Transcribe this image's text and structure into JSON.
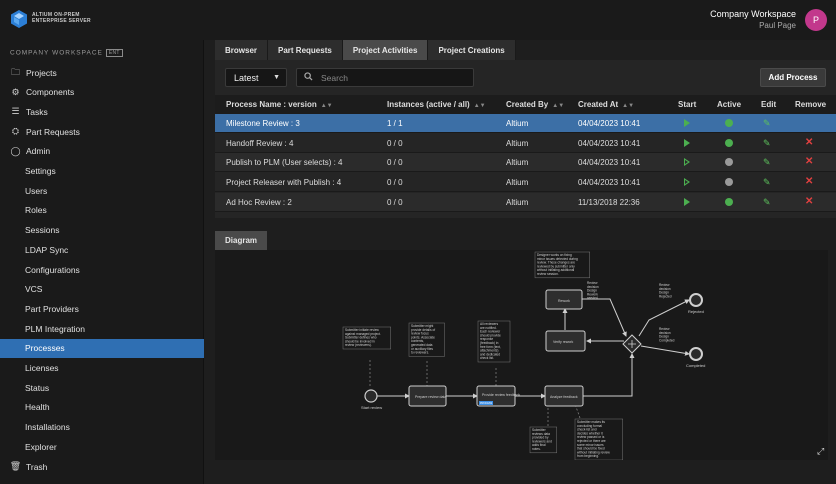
{
  "brand": {
    "line1": "ALTIUM ON-PREM",
    "line2": "ENTERPRISE SERVER"
  },
  "header": {
    "workspace": "Company Workspace",
    "user": "Paul Page",
    "avatar_initial": "P",
    "avatar_color": "#c2388c"
  },
  "sidebar": {
    "section": "COMPANY WORKSPACE",
    "badge": "ENT",
    "items": [
      {
        "label": "Projects",
        "icon": "folder-icon",
        "sub": false
      },
      {
        "label": "Components",
        "icon": "components-icon",
        "sub": false
      },
      {
        "label": "Tasks",
        "icon": "tasks-icon",
        "sub": false
      },
      {
        "label": "Part Requests",
        "icon": "part-requests-icon",
        "sub": false
      },
      {
        "label": "Admin",
        "icon": "admin-icon",
        "sub": false
      },
      {
        "label": "Settings",
        "sub": true
      },
      {
        "label": "Users",
        "sub": true
      },
      {
        "label": "Roles",
        "sub": true
      },
      {
        "label": "Sessions",
        "sub": true
      },
      {
        "label": "LDAP Sync",
        "sub": true
      },
      {
        "label": "Configurations",
        "sub": true
      },
      {
        "label": "VCS",
        "sub": true
      },
      {
        "label": "Part Providers",
        "sub": true
      },
      {
        "label": "PLM Integration",
        "sub": true
      },
      {
        "label": "Processes",
        "sub": true,
        "active": true
      },
      {
        "label": "Licenses",
        "sub": true
      },
      {
        "label": "Status",
        "sub": true
      },
      {
        "label": "Health",
        "sub": true
      },
      {
        "label": "Installations",
        "sub": true
      },
      {
        "label": "Explorer",
        "sub": true
      },
      {
        "label": "Trash",
        "icon": "trash-icon",
        "sub": false
      }
    ]
  },
  "tabs": [
    "Browser",
    "Part Requests",
    "Project Activities",
    "Project Creations"
  ],
  "active_tab": "Project Activities",
  "toolbar": {
    "filter_value": "Latest",
    "search_placeholder": "Search",
    "add_label": "Add Process"
  },
  "table": {
    "columns": [
      "Process Name : version",
      "Instances (active / all)",
      "Created By",
      "Created At",
      "Start",
      "Active",
      "Edit",
      "Remove"
    ],
    "rows": [
      {
        "name": "Milestone Review : 3",
        "instances": "1 / 1",
        "by": "Altium",
        "at": "04/04/2023 10:41",
        "start_filled": true,
        "active": true,
        "selected": true
      },
      {
        "name": "Handoff Review : 4",
        "instances": "0 / 0",
        "by": "Altium",
        "at": "04/04/2023 10:41",
        "start_filled": true,
        "active": true
      },
      {
        "name": "Publish to PLM (User selects) : 4",
        "instances": "0 / 0",
        "by": "Altium",
        "at": "04/04/2023 10:41",
        "start_filled": false,
        "active": false
      },
      {
        "name": "Project Releaser with Publish : 4",
        "instances": "0 / 0",
        "by": "Altium",
        "at": "04/04/2023 10:41",
        "start_filled": false,
        "active": false
      },
      {
        "name": "Ad Hoc Review : 2",
        "instances": "0 / 0",
        "by": "Altium",
        "at": "11/13/2018 22:36",
        "start_filled": true,
        "active": true
      }
    ]
  },
  "status_colors": {
    "active": "#4caf50",
    "inactive": "#9a9a9a",
    "start": "#4caf50",
    "edit": "#5cc05c",
    "remove": "#e04040"
  },
  "diagram": {
    "tab": "Diagram",
    "nodes": {
      "start": "Start review",
      "prepare": "Prepare review data",
      "provide": "Provide review feedback",
      "analyze": "Analyze feedback",
      "rework": "Rework",
      "verify": "Verify rework",
      "rejected": "Rejected",
      "completed": "Completed",
      "badge": "PROCESS"
    },
    "notes": {
      "n1": [
        "Submitter initiate review",
        "against managed project.",
        "Submitter defines who",
        "should be involved in",
        "review (reviewers)."
      ],
      "n2": [
        "Submitter might",
        "provide details of",
        "review focus",
        "points. Associate",
        "contents,",
        "generated data",
        "or auxiliary files",
        "to reviewers."
      ],
      "n3": [
        "All reviewers",
        "are notified.",
        "Each reviewer",
        "should provide",
        "response",
        "(feedback) in",
        "free form (text,",
        "attachments)",
        "and dedicated",
        "check list."
      ],
      "n4": [
        "Designer works on fixing",
        "minor issues detected during",
        "review. These changes are",
        "reviewed by submitter only",
        "without initiating additional",
        "review session."
      ],
      "n5": [
        "Submitter",
        "reviews data",
        "provided by",
        "reviewers and",
        "adds final",
        "notes."
      ],
      "n6": [
        "Submitter makes its",
        "concluding formal",
        "check-list and",
        "decides whether it",
        "review passed or is",
        "rejected or there are",
        "some minor issues",
        "that should be fixed",
        "without initiating review",
        "from beginning."
      ],
      "e1": [
        "Review",
        "decision",
        "Design",
        "Rework",
        "needed"
      ],
      "e2": [
        "Review",
        "decision",
        "Design",
        "Rejected"
      ],
      "e3": [
        "Review",
        "decision",
        "Design",
        "Completed"
      ]
    }
  }
}
